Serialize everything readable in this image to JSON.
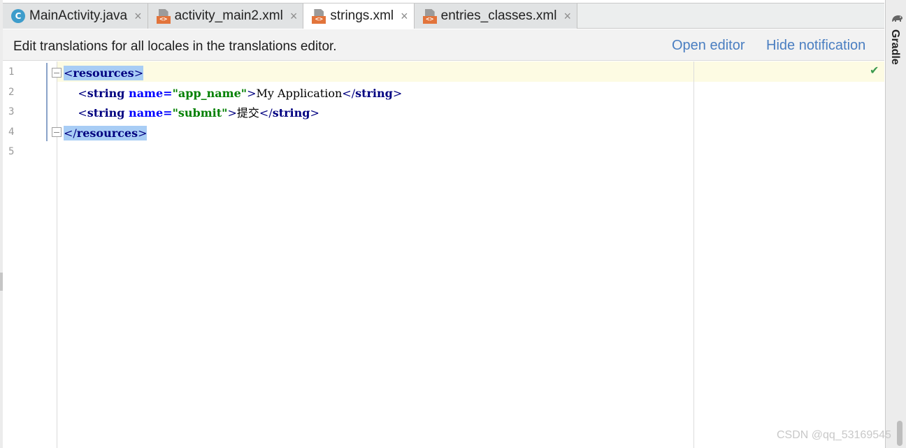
{
  "tabs": [
    {
      "label": "MainActivity.java",
      "icon": "java-class-icon",
      "icon_letter": "C",
      "active": false
    },
    {
      "label": "activity_main2.xml",
      "icon": "xml-file-icon",
      "active": false
    },
    {
      "label": "strings.xml",
      "icon": "xml-file-icon",
      "active": true
    },
    {
      "label": "entries_classes.xml",
      "icon": "xml-file-icon",
      "active": false
    }
  ],
  "close_glyph": "×",
  "xml_badge": "<>",
  "notification": {
    "text": "Edit translations for all locales in the translations editor.",
    "open_editor": "Open editor",
    "hide_notification": "Hide notification"
  },
  "side_panel": {
    "gradle_label": "Gradle"
  },
  "editor": {
    "line_numbers": [
      "1",
      "2",
      "3",
      "4",
      "5"
    ],
    "code": {
      "l1_open": "<",
      "l1_tag": "resources",
      "l1_close": ">",
      "l2_open": "    <",
      "l2_tag": "string",
      "l2_attr": " name=",
      "l2_val": "\"app_name\"",
      "l2_gt": ">",
      "l2_text": "My Application",
      "l2_end_open": "</",
      "l2_end_tag": "string",
      "l2_end_close": ">",
      "l3_open": "    <",
      "l3_tag": "string",
      "l3_attr": " name=",
      "l3_val": "\"submit\"",
      "l3_gt": ">",
      "l3_text": "提交",
      "l3_end_open": "</",
      "l3_end_tag": "string",
      "l3_end_close": ">",
      "l4_open": "</",
      "l4_tag": "resources",
      "l4_close": ">"
    },
    "status_icon": "check-icon",
    "status_glyph": "✔"
  },
  "watermark": "CSDN @qq_53169545",
  "colors": {
    "link": "#4a7ec1",
    "tag": "#000080",
    "attr_value": "#008000",
    "selection": "#a8cdf5",
    "current_line": "#fdfbe3"
  }
}
